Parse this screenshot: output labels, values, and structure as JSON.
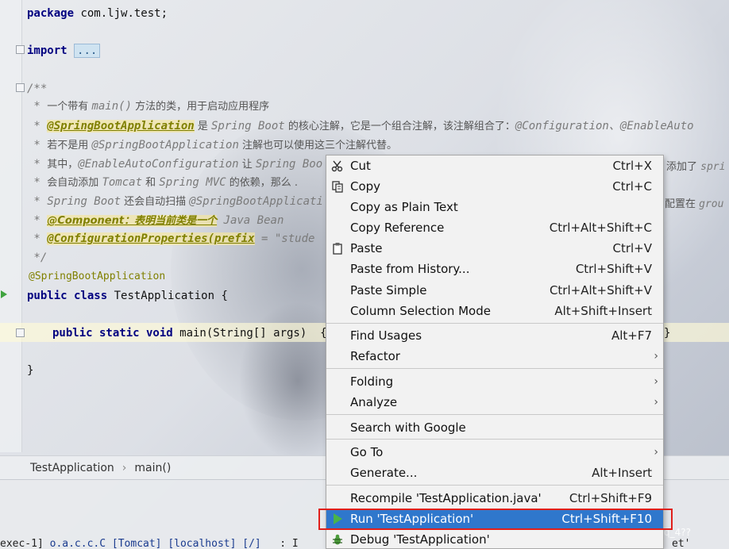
{
  "editor": {
    "lines": {
      "package_kw": "package",
      "package_name": " com.ljw.test;",
      "import_kw": "import",
      "import_fold": "...",
      "doc_open": "/**",
      "c1_star": " * ",
      "c1_a": "一个带有 ",
      "c1_b": "main()",
      "c1_c": " 方法的类，用于启动应用程序",
      "c2_tag": "@SpringBootApplication",
      "c2_a": " 是 ",
      "c2_b": "Spring Boot",
      "c2_c": " 的核心注解，它是一个组合注解，该注解组合了：",
      "c2_d": "@Configuration、@EnableAuto",
      "c3_a": "若不是用 ",
      "c3_b": "@SpringBootApplication",
      "c3_c": " 注解也可以使用这三个注解代替。",
      "c4_a": "其中，",
      "c4_b": "@EnableAutoConfiguration",
      "c4_c": " 让 ",
      "c4_d": "Spring Boo",
      "c4_tail_a": "添加了 ",
      "c4_tail_b": "spri",
      "c5_a": "会自动添加 ",
      "c5_b": "Tomcat",
      "c5_c": " 和 ",
      "c5_d": "Spring MVC",
      "c5_e": " 的依赖，那么 .",
      "c6_a": "Spring Boot",
      "c6_b": " 还会自动扫描 ",
      "c6_c": "@SpringBootApplicati",
      "c6_tail_a": "配置在 ",
      "c6_tail_b": "grou",
      "c7_tag": "@Component：表明当前类是一个",
      "c7_b": " Java Bean",
      "c8_tag": "@ConfigurationProperties(prefix",
      "c8_b": " = \"stude",
      "doc_close": " */",
      "annotation": "@SpringBootApplication",
      "class_kw": "public class",
      "class_name": " TestApplication {",
      "main_kw": "public static void",
      "main_sig": " main(String[] args)  {",
      "main_close": "}",
      "class_close": "}"
    }
  },
  "breadcrumb": {
    "class": "TestApplication",
    "separator": "›",
    "method": "main()"
  },
  "console": {
    "prefix": "exec-1]",
    "links": "o.a.c.c.C [Tomcat] [localhost] [/]",
    "tail": ": I",
    "end": "et'"
  },
  "watermark": "https://blog.csdn.net/qq_4??",
  "context_menu": {
    "items": [
      {
        "label": "Cut",
        "shortcut": "Ctrl+X",
        "icon": "scissors-icon"
      },
      {
        "label": "Copy",
        "shortcut": "Ctrl+C",
        "icon": "copy-icon"
      },
      {
        "label": "Copy as Plain Text",
        "shortcut": ""
      },
      {
        "label": "Copy Reference",
        "shortcut": "Ctrl+Alt+Shift+C"
      },
      {
        "label": "Paste",
        "shortcut": "Ctrl+V",
        "icon": "clipboard-icon"
      },
      {
        "label": "Paste from History...",
        "shortcut": "Ctrl+Shift+V"
      },
      {
        "label": "Paste Simple",
        "shortcut": "Ctrl+Alt+Shift+V"
      },
      {
        "label": "Column Selection Mode",
        "shortcut": "Alt+Shift+Insert"
      },
      {
        "label": "Find Usages",
        "shortcut": "Alt+F7"
      },
      {
        "label": "Refactor",
        "shortcut": "",
        "submenu": true
      },
      {
        "label": "Folding",
        "shortcut": "",
        "submenu": true
      },
      {
        "label": "Analyze",
        "shortcut": "",
        "submenu": true
      },
      {
        "label": "Search with Google",
        "shortcut": ""
      },
      {
        "label": "Go To",
        "shortcut": "",
        "submenu": true
      },
      {
        "label": "Generate...",
        "shortcut": "Alt+Insert"
      },
      {
        "label": "Recompile 'TestApplication.java'",
        "shortcut": "Ctrl+Shift+F9"
      },
      {
        "label": "Run 'TestApplication'",
        "shortcut": "Ctrl+Shift+F10",
        "icon": "run-icon",
        "active": true
      },
      {
        "label": "Debug 'TestApplication'",
        "shortcut": "",
        "icon": "debug-icon"
      }
    ]
  },
  "colors": {
    "menu_highlight": "#2f77cc",
    "red_box": "#e0201b",
    "keyword": "#000080",
    "annotation": "#808000"
  }
}
